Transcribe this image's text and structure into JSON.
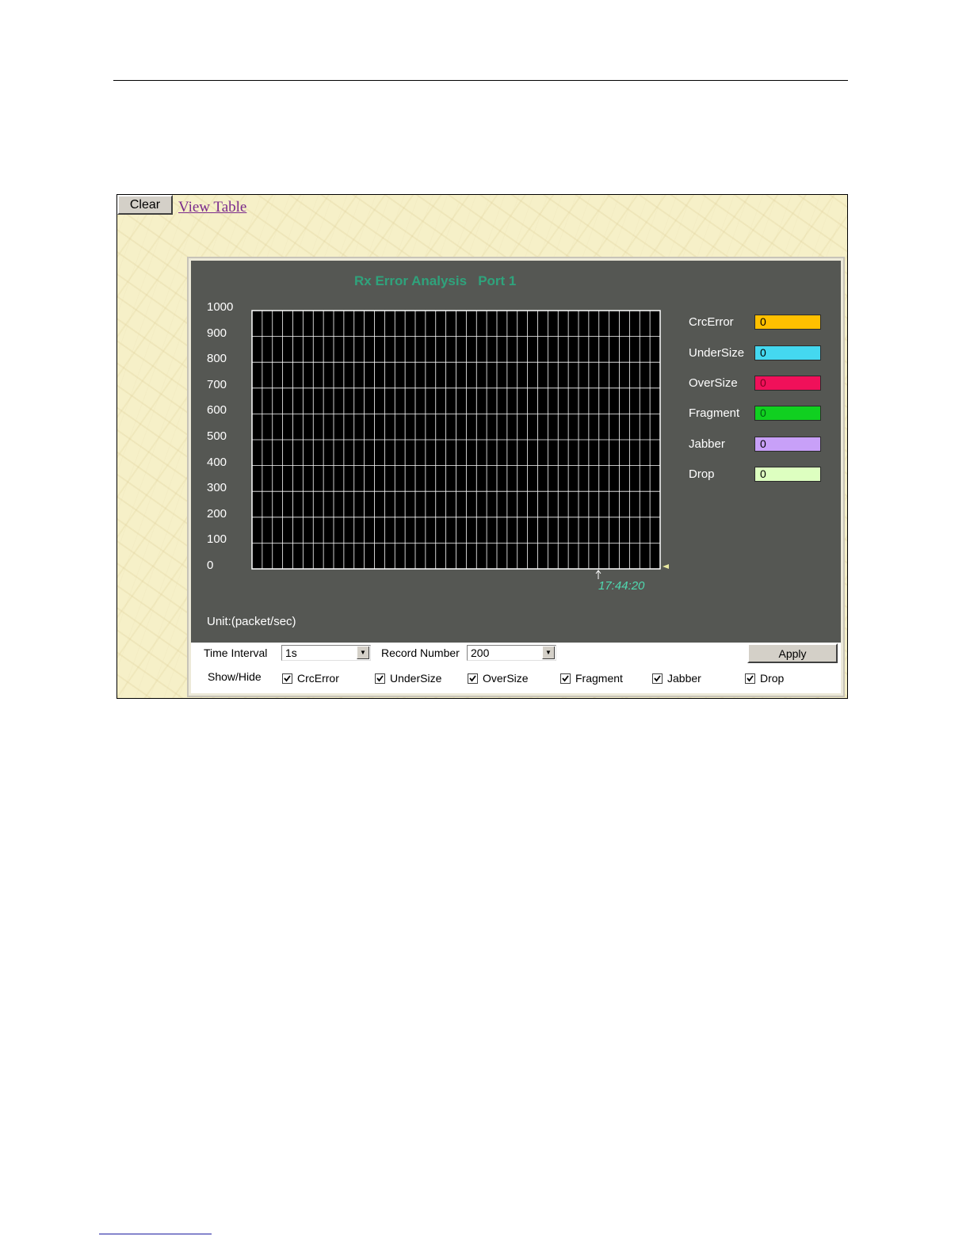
{
  "toolbar": {
    "clear_label": "Clear",
    "view_table_label": "View Table"
  },
  "chart": {
    "title": "Rx Error Analysis   Port 1",
    "time_label": "17:44:20",
    "unit_label": "Unit:(packet/sec)"
  },
  "legend": [
    {
      "name": "CrcError",
      "value": "0",
      "color": "#ffc000"
    },
    {
      "name": "UnderSize",
      "value": "0",
      "color": "#44d8f0"
    },
    {
      "name": "OverSize",
      "value": "0",
      "color": "#f0105a"
    },
    {
      "name": "Fragment",
      "value": "0",
      "color": "#10d020"
    },
    {
      "name": "Jabber",
      "value": "0",
      "color": "#c8a0f8"
    },
    {
      "name": "Drop",
      "value": "0",
      "color": "#ddffc0"
    }
  ],
  "controls": {
    "time_interval_label": "Time Interval",
    "time_interval_value": "1s",
    "record_number_label": "Record Number",
    "record_number_value": "200",
    "apply_label": "Apply",
    "show_hide_label": "Show/Hide",
    "checkboxes": [
      {
        "label": "CrcError",
        "checked": true
      },
      {
        "label": "UnderSize",
        "checked": true
      },
      {
        "label": "OverSize",
        "checked": true
      },
      {
        "label": "Fragment",
        "checked": true
      },
      {
        "label": "Jabber",
        "checked": true
      },
      {
        "label": "Drop",
        "checked": true
      }
    ]
  },
  "chart_data": {
    "type": "line",
    "title": "Rx Error Analysis   Port 1",
    "ylabel": "Unit:(packet/sec)",
    "ylim": [
      0,
      1000
    ],
    "y_ticks": [
      "1000",
      "900",
      "800",
      "700",
      "600",
      "500",
      "400",
      "300",
      "200",
      "100",
      "0"
    ],
    "x_ticks": [
      "17:44:20"
    ],
    "grid": true,
    "legend_position": "right",
    "series": [
      {
        "name": "CrcError",
        "values": [
          0
        ]
      },
      {
        "name": "UnderSize",
        "values": [
          0
        ]
      },
      {
        "name": "OverSize",
        "values": [
          0
        ]
      },
      {
        "name": "Fragment",
        "values": [
          0
        ]
      },
      {
        "name": "Jabber",
        "values": [
          0
        ]
      },
      {
        "name": "Drop",
        "values": [
          0
        ]
      }
    ]
  }
}
